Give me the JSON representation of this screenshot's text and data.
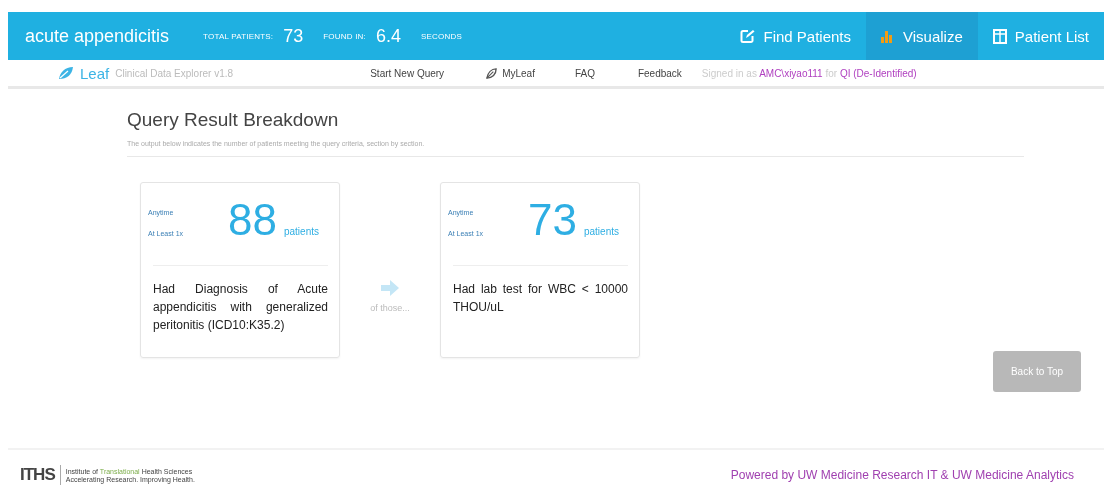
{
  "header": {
    "query_name": "acute appendicitis",
    "total_label": "TOTAL PATIENTS:",
    "total": "73",
    "found_label": "FOUND IN:",
    "found": "6.4",
    "seconds_label": "SECONDS",
    "tabs": [
      {
        "label": "Find Patients",
        "kind": "edit",
        "selected": false
      },
      {
        "label": "Visualize",
        "kind": "bars",
        "selected": true
      },
      {
        "label": "Patient List",
        "kind": "table",
        "selected": false
      }
    ]
  },
  "nav": {
    "brand": "Leaf",
    "subtitle": "Clinical Data Explorer v1.8",
    "links": [
      {
        "label": "Start New Query",
        "kind": "text"
      },
      {
        "label": "MyLeaf",
        "kind": "leaf"
      },
      {
        "label": "FAQ",
        "kind": "text"
      },
      {
        "label": "Feedback",
        "kind": "text"
      }
    ],
    "signed_in": {
      "prefix": "Signed in as",
      "user": "AMC\\xiyao111",
      "joiner": "for",
      "group": "QI (De-Identified)"
    }
  },
  "breakdown": {
    "title": "Query Result Breakdown",
    "subtitle": "The output below indicates the number of patients meeting the query criteria, section by section.",
    "connector": "of those...",
    "cards": [
      {
        "timing": "Anytime",
        "frequency": "At Least 1x",
        "count": "88",
        "unit": "patients",
        "description": "Had Diagnosis of Acute appendicitis with generalized peritonitis (ICD10:K35.2)"
      },
      {
        "timing": "Anytime",
        "frequency": "At Least 1x",
        "count": "73",
        "unit": "patients",
        "description": "Had lab test for WBC < 10000 THOU/uL"
      }
    ],
    "back_button": "Back to Top"
  },
  "footer": {
    "logo_letters": "ITHS",
    "logo_name": [
      "Institute of",
      "Translational",
      "Health Sciences"
    ],
    "logo_tagline": "Accelerating Research. Improving Health.",
    "powered_by": "Powered by UW Medicine Research IT & UW Medicine Analytics"
  }
}
